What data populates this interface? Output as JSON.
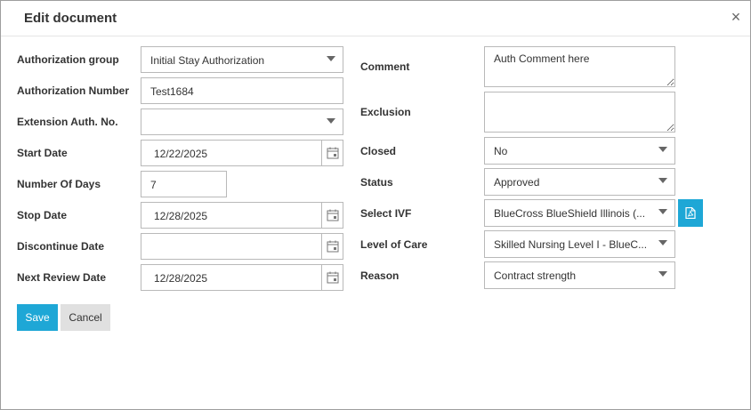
{
  "dialog": {
    "title": "Edit document",
    "close_label": "×"
  },
  "left": {
    "auth_group": {
      "label": "Authorization group",
      "value": "Initial Stay Authorization"
    },
    "auth_number": {
      "label": "Authorization Number",
      "value": "Test1684"
    },
    "extension": {
      "label": "Extension Auth. No.",
      "value": ""
    },
    "start_date": {
      "label": "Start Date",
      "value": "12/22/2025"
    },
    "num_days": {
      "label": "Number Of Days",
      "value": "7"
    },
    "stop_date": {
      "label": "Stop Date",
      "value": "12/28/2025"
    },
    "discontinue_date": {
      "label": "Discontinue Date",
      "value": ""
    },
    "next_review": {
      "label": "Next Review Date",
      "value": "12/28/2025"
    }
  },
  "right": {
    "comment": {
      "label": "Comment",
      "value": "Auth Comment here"
    },
    "exclusion": {
      "label": "Exclusion",
      "value": ""
    },
    "closed": {
      "label": "Closed",
      "value": "No"
    },
    "status": {
      "label": "Status",
      "value": "Approved"
    },
    "ivf": {
      "label": "Select IVF",
      "value": "BlueCross BlueShield Illinois (..."
    },
    "level_of_care": {
      "label": "Level of Care",
      "value": "Skilled Nursing Level I - BlueC..."
    },
    "reason": {
      "label": "Reason",
      "value": "Contract strength"
    }
  },
  "buttons": {
    "save": "Save",
    "cancel": "Cancel"
  },
  "icons": {
    "calendar": "calendar-icon",
    "pdf": "pdf-file-icon",
    "dropdown": "chevron-down-icon",
    "close": "close-icon"
  },
  "colors": {
    "accent": "#1ea7d6",
    "cancel_bg": "#e0e0e0",
    "border": "#b9b9b9"
  }
}
